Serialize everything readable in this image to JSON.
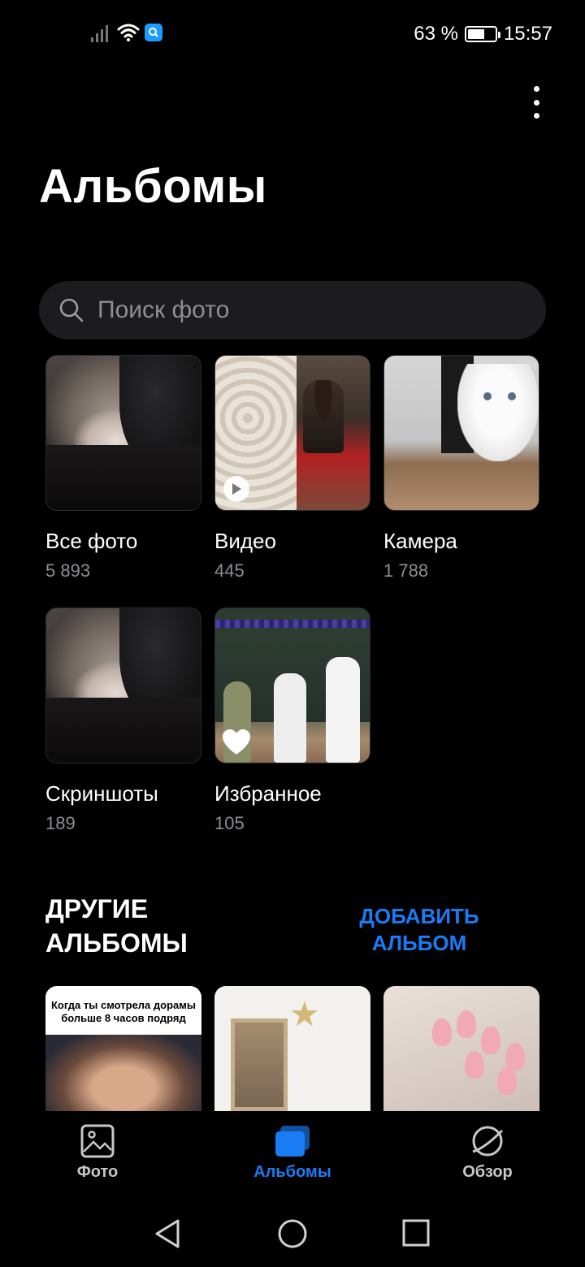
{
  "status_bar": {
    "battery_percent": "63 %",
    "battery_level": 0.63,
    "time": "15:57",
    "icons": [
      "signal-icon",
      "wifi-icon",
      "app-notification-icon",
      "battery-icon"
    ]
  },
  "header": {
    "title": "Альбомы",
    "menu_icon": "more-vertical-icon"
  },
  "search": {
    "placeholder": "Поиск фото",
    "icon": "search-icon"
  },
  "albums": [
    {
      "name": "Все фото",
      "count": "5 893"
    },
    {
      "name": "Видео",
      "count": "445"
    },
    {
      "name": "Камера",
      "count": "1 788"
    },
    {
      "name": "Скриншоты",
      "count": "189"
    },
    {
      "name": "Избранное",
      "count": "105"
    }
  ],
  "other_albums": {
    "title_line1": "ДРУГИЕ",
    "title_line2": "АЛЬБОМЫ",
    "add_line1": "ДОБАВИТЬ",
    "add_line2": "АЛЬБОМ",
    "first_thumb_caption_line1": "Когда ты смотрела дорамы",
    "first_thumb_caption_line2": "больше 8 часов подряд"
  },
  "bottom_nav": {
    "items": [
      {
        "label": "Фото",
        "icon": "photo-icon",
        "active": false
      },
      {
        "label": "Альбомы",
        "icon": "albums-icon",
        "active": true
      },
      {
        "label": "Обзор",
        "icon": "discover-icon",
        "active": false
      }
    ]
  },
  "system_nav": [
    "back-icon",
    "home-icon",
    "recents-icon"
  ],
  "colors": {
    "accent": "#1a7cf5",
    "background": "#000000",
    "secondary_text": "#8e8e93",
    "search_bg": "#1c1c1e"
  }
}
